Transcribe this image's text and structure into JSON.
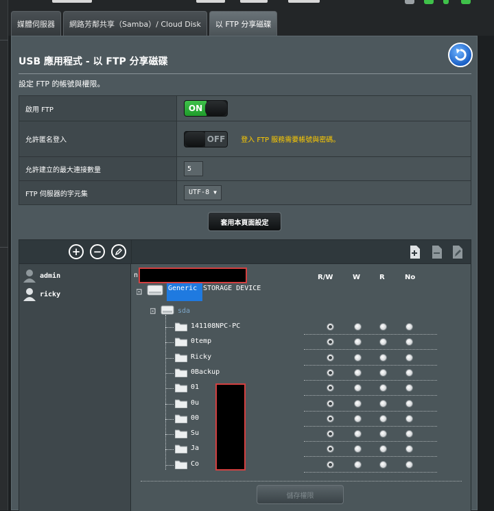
{
  "tabs": [
    {
      "label": "媒體伺服器",
      "active": false
    },
    {
      "label": "網路芳鄰共享（Samba）/ Cloud Disk",
      "active": false
    },
    {
      "label": "以 FTP 分享磁碟",
      "active": true
    }
  ],
  "page": {
    "title": "USB 應用程式 - 以 FTP 分享磁碟",
    "description": "設定 FTP 的帳號與權限。"
  },
  "settings": {
    "enable_ftp": {
      "label": "啟用 FTP",
      "state": "ON"
    },
    "anonymous": {
      "label": "允許匿名登入",
      "state": "OFF",
      "hint": "登入 FTP 服務需要帳號與密碼。"
    },
    "max_conn": {
      "label": "允許建立的最大連接數量",
      "value": "5"
    },
    "charset": {
      "label": "FTP 伺服器的字元集",
      "value": "UTF-8"
    }
  },
  "apply_button": "套用本頁面設定",
  "users": [
    {
      "name": "admin"
    },
    {
      "name": "ricky"
    }
  ],
  "permission_headers": [
    "R/W",
    "W",
    "R",
    "No"
  ],
  "tree": {
    "root_prefix": "n",
    "device_word1": "Generic",
    "device_word2": "STORAGE DEVICE",
    "partition": "sda",
    "folders": [
      {
        "name": "141108NPC-PC",
        "perm": "R/W"
      },
      {
        "name": "0temp",
        "perm": "R/W"
      },
      {
        "name": "Ricky",
        "perm": "R/W"
      },
      {
        "name": "0Backup",
        "perm": "R/W"
      },
      {
        "name": "01",
        "perm": "R/W"
      },
      {
        "name": "0u",
        "perm": "R/W"
      },
      {
        "name": "00",
        "perm": "R/W"
      },
      {
        "name": "Su",
        "perm": "R/W"
      },
      {
        "name": "Ja",
        "perm": "R/W"
      },
      {
        "name": "Co",
        "perm": "R/W"
      }
    ]
  },
  "save_button": "儲存權限",
  "colors": {
    "on_green": "#2cb036",
    "hint_yellow": "#ffcc00",
    "panel_bg": "#4d585d",
    "redaction_border": "#d44040"
  },
  "icons": {
    "back": "back-arrow-icon",
    "add_user": "plus-circle-icon",
    "remove_user": "minus-circle-icon",
    "edit_user": "pencil-circle-icon",
    "add_folder": "add-document-icon",
    "delete_folder": "document-icon",
    "edit_folder": "edit-document-icon"
  }
}
